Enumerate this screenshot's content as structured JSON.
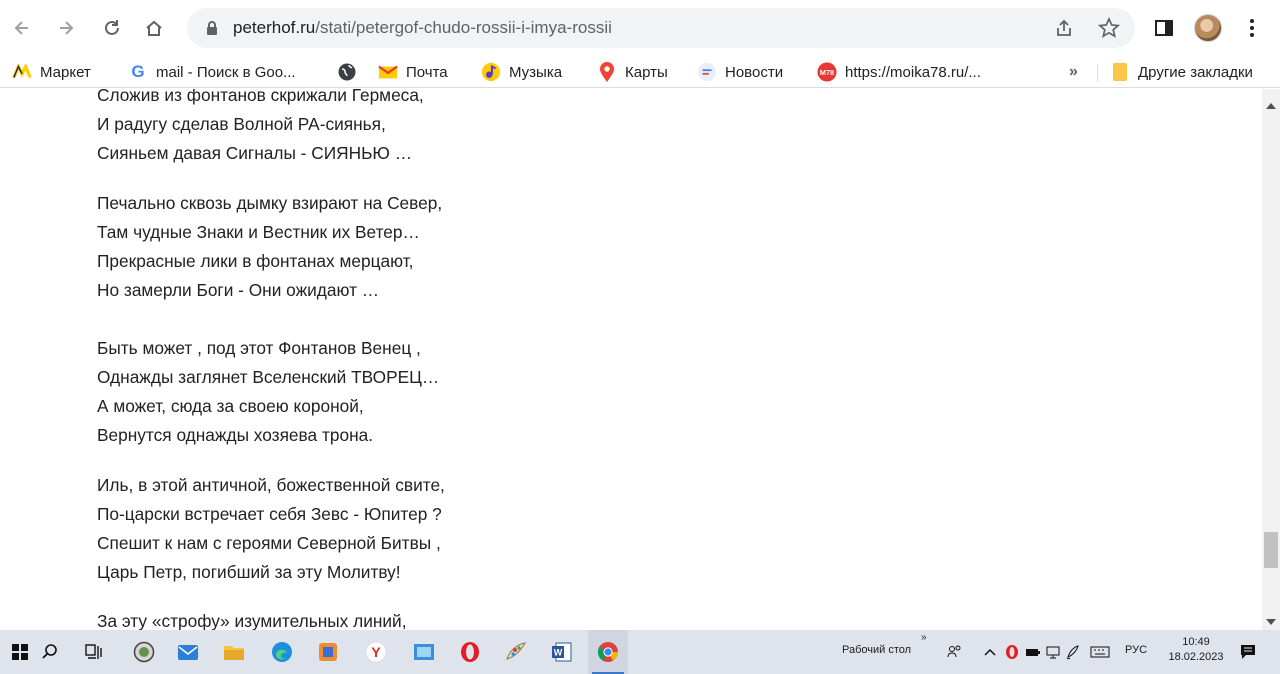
{
  "browser": {
    "url_host": "peterhof.ru",
    "url_path": "/stati/petergof-chudo-rossii-i-imya-rossii"
  },
  "bookmarks": [
    {
      "label": "Маркет",
      "icon": "yandex-market-icon"
    },
    {
      "label": "mail - Поиск в Goo...",
      "icon": "google-icon"
    },
    {
      "label": "",
      "icon": "globe-icon"
    },
    {
      "label": "Почта",
      "icon": "mail-icon"
    },
    {
      "label": "Музыка",
      "icon": "music-icon"
    },
    {
      "label": "Карты",
      "icon": "map-pin-icon"
    },
    {
      "label": "Новости",
      "icon": "news-icon"
    },
    {
      "label": "https://moika78.ru/...",
      "icon": "moika78-icon"
    }
  ],
  "bookmarks_more": "»",
  "other_bookmarks": "Другие закладки",
  "poem": {
    "lines": [
      "Сложив из фонтанов скрижали Гермеса,",
      "И радугу сделав Волной РА-сиянья,",
      "Сияньем давая Сигналы - СИЯНЬЮ …",
      "Печально сквозь дымку взирают на Север,",
      "Там чудные Знаки и Вестник их Ветер…",
      "Прекрасные лики в фонтанах мерцают,",
      "Но замерли Боги - Они ожидают …",
      "Быть может , под этот Фонтанов Венец ,",
      "Однажды заглянет Вселенский ТВОРЕЦ…",
      "А может, сюда за своею короной,",
      "Вернутся однажды хозяева трона.",
      "Иль, в этой античной, божественной свите,",
      "По-царски встречает себя Зевс - Юпитер ?",
      "Спешит к нам с героями Северной Битвы ,",
      "Царь Петр, погибший за эту Молитву!",
      "За эту «строфу» изумительных линий,"
    ]
  },
  "taskbar": {
    "desktop_label": "Рабочий стол",
    "language": "РУС",
    "time": "10:49",
    "date": "18.02.2023"
  },
  "colors": {
    "taskbar_bg": "#dfe4ec",
    "omnibox_bg": "#f1f3f4",
    "accent": "#3a78c9"
  }
}
